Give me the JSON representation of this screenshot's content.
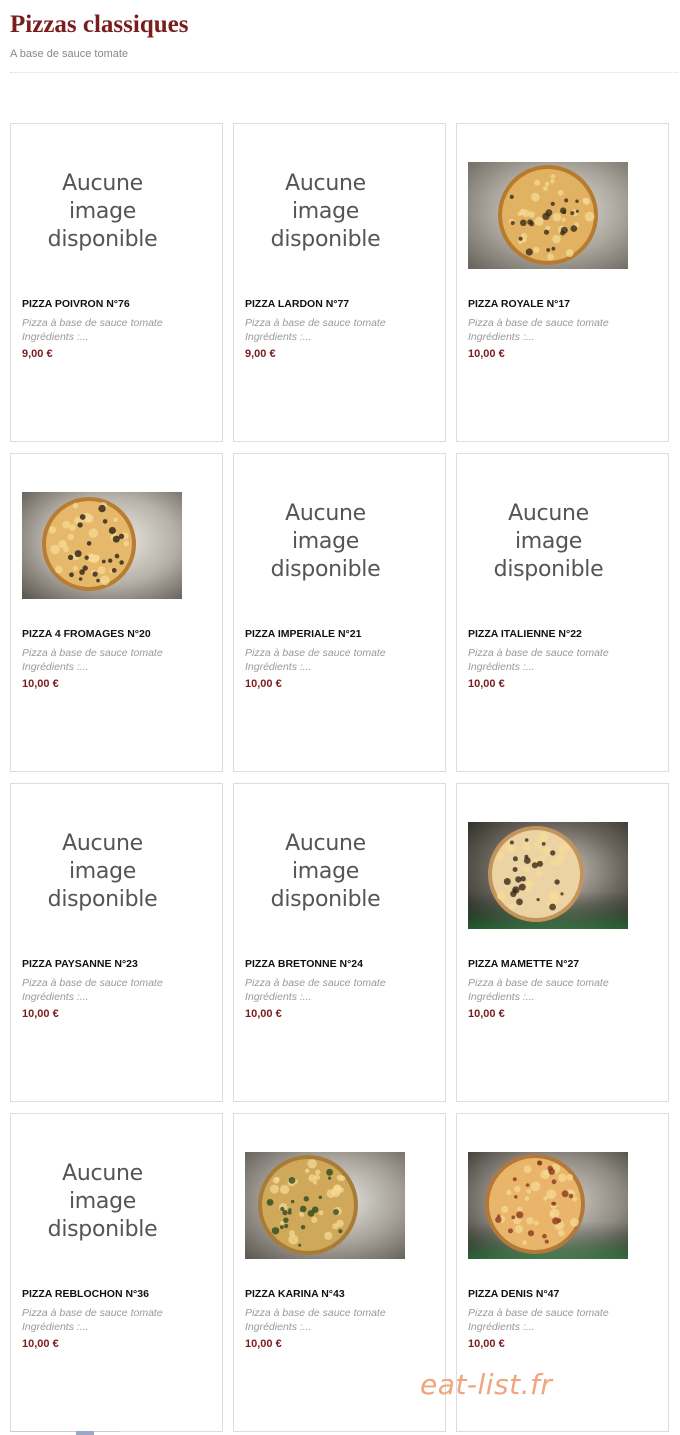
{
  "header": {
    "title": "Pizzas classiques",
    "subtitle": "A base de sauce tomate"
  },
  "no_image_text": [
    "Aucune",
    "image",
    "disponible"
  ],
  "products": [
    {
      "name": "PIZZA POIVRON N°76",
      "desc": "Pizza à base de sauce tomate",
      "ingredients": "Ingrédients :...",
      "price": "9,00 €",
      "image": "none"
    },
    {
      "name": "PIZZA LARDON N°77",
      "desc": "Pizza à base de sauce tomate",
      "ingredients": "Ingrédients :...",
      "price": "9,00 €",
      "image": "none"
    },
    {
      "name": "PIZZA ROYALE N°17",
      "desc": "Pizza à base de sauce tomate",
      "ingredients": "Ingrédients :...",
      "price": "10,00 €",
      "image": "pizza-photo"
    },
    {
      "name": "PIZZA 4 FROMAGES N°20",
      "desc": "Pizza à base de sauce tomate",
      "ingredients": "Ingrédients :...",
      "price": "10,00 €",
      "image": "pizza-photo"
    },
    {
      "name": "PIZZA IMPERIALE N°21",
      "desc": "Pizza à base de sauce tomate",
      "ingredients": "Ingrédients :...",
      "price": "10,00 €",
      "image": "none"
    },
    {
      "name": "PIZZA ITALIENNE N°22",
      "desc": "Pizza à base de sauce tomate",
      "ingredients": "Ingrédients :...",
      "price": "10,00 €",
      "image": "none"
    },
    {
      "name": "PIZZA PAYSANNE N°23",
      "desc": "Pizza à base de sauce tomate",
      "ingredients": "Ingrédients :...",
      "price": "10,00 €",
      "image": "none"
    },
    {
      "name": "PIZZA BRETONNE N°24",
      "desc": "Pizza à base de sauce tomate",
      "ingredients": "Ingrédients :...",
      "price": "10,00 €",
      "image": "none"
    },
    {
      "name": "PIZZA MAMETTE N°27",
      "desc": "Pizza à base de sauce tomate",
      "ingredients": "Ingrédients :...",
      "price": "10,00 €",
      "image": "pizza-photo"
    },
    {
      "name": "PIZZA REBLOCHON N°36",
      "desc": "Pizza à base de sauce tomate",
      "ingredients": "Ingrédients :...",
      "price": "10,00 €",
      "image": "none"
    },
    {
      "name": "PIZZA KARINA N°43",
      "desc": "Pizza à base de sauce tomate",
      "ingredients": "Ingrédients :...",
      "price": "10,00 €",
      "image": "pizza-photo"
    },
    {
      "name": "PIZZA DENIS N°47",
      "desc": "Pizza à base de sauce tomate",
      "ingredients": "Ingrédients :...",
      "price": "10,00 €",
      "image": "pizza-photo"
    }
  ],
  "watermark": "eat-list.fr",
  "colors": {
    "title": "#7a1d1f",
    "price": "#7a1d1f",
    "watermark": "#f0a57e",
    "card_border": "#dddddd"
  }
}
